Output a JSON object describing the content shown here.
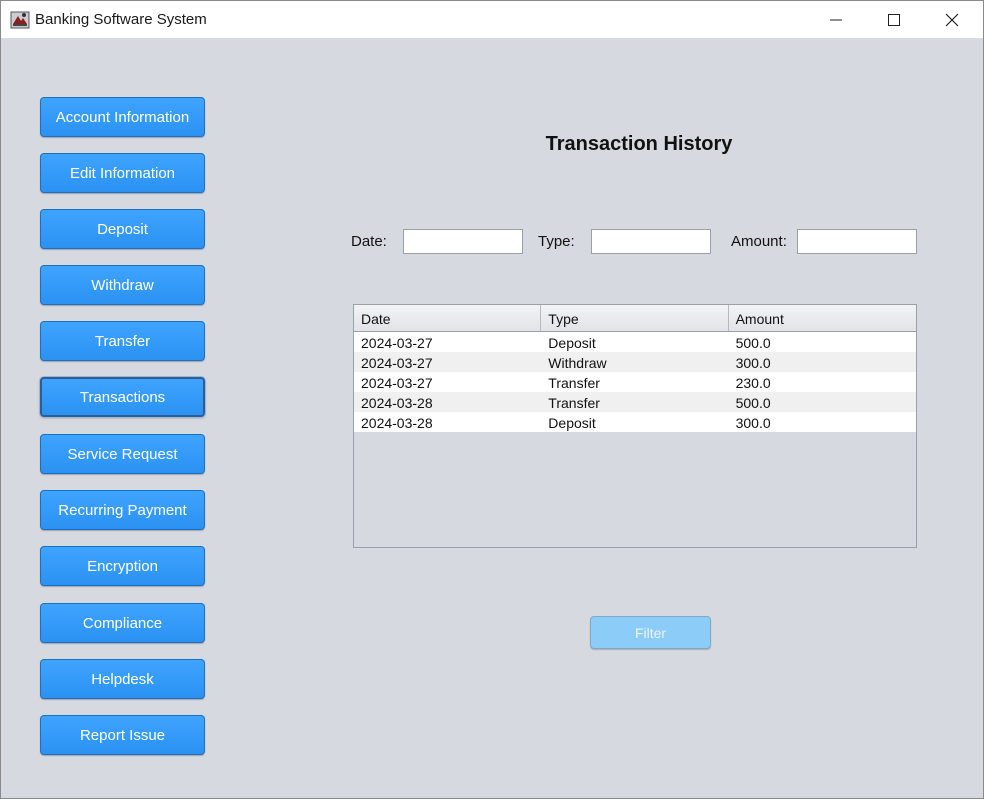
{
  "window": {
    "title": "Banking Software System"
  },
  "sidebar": {
    "items": [
      {
        "label": "Account Information"
      },
      {
        "label": "Edit Information"
      },
      {
        "label": "Deposit"
      },
      {
        "label": "Withdraw"
      },
      {
        "label": "Transfer"
      },
      {
        "label": "Transactions"
      },
      {
        "label": "Service Request"
      },
      {
        "label": "Recurring Payment"
      },
      {
        "label": "Encryption"
      },
      {
        "label": "Compliance"
      },
      {
        "label": "Helpdesk"
      },
      {
        "label": "Report Issue"
      }
    ],
    "active": "Transactions"
  },
  "main": {
    "title": "Transaction History",
    "filters": {
      "date_label": "Date:",
      "date_value": "",
      "type_label": "Type:",
      "type_value": "",
      "amount_label": "Amount:",
      "amount_value": ""
    },
    "table": {
      "columns": [
        "Date",
        "Type",
        "Amount"
      ],
      "rows": [
        [
          "2024-03-27",
          "Deposit",
          "500.0"
        ],
        [
          "2024-03-27",
          "Withdraw",
          "300.0"
        ],
        [
          "2024-03-27",
          "Transfer",
          "230.0"
        ],
        [
          "2024-03-28",
          "Transfer",
          "500.0"
        ],
        [
          "2024-03-28",
          "Deposit",
          "300.0"
        ]
      ]
    },
    "filter_button": "Filter"
  },
  "colors": {
    "button_blue": "#2b92f2",
    "button_disabled": "#8cccf8",
    "background": "#d6d9df"
  }
}
